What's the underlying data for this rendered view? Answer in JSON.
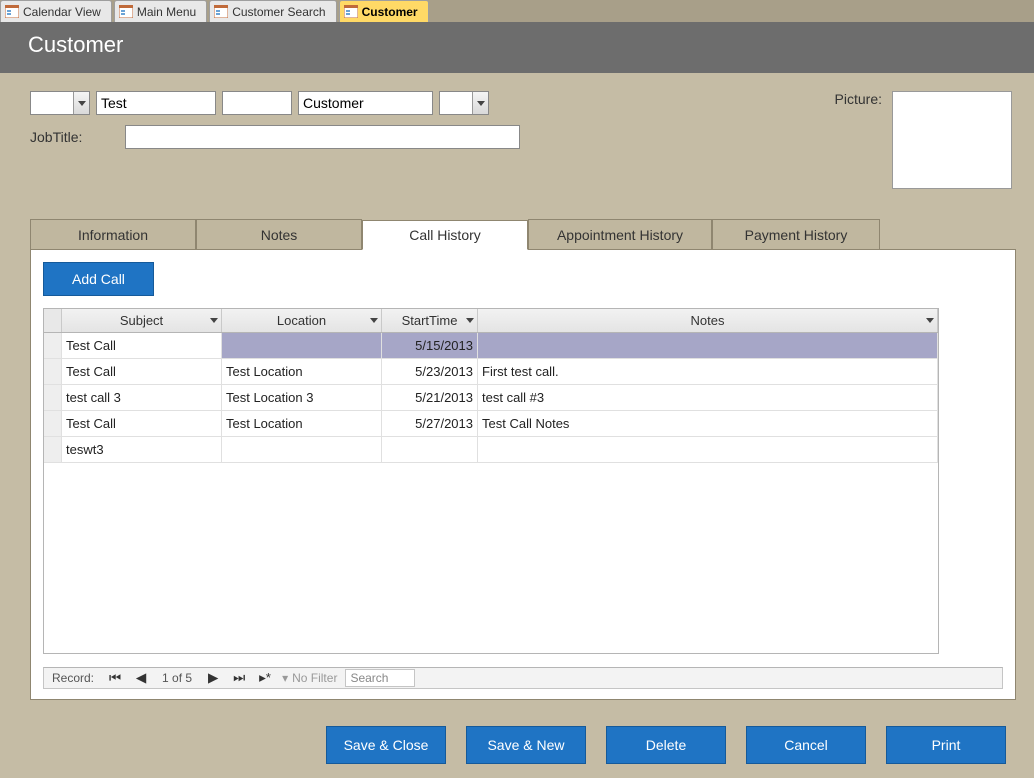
{
  "doc_tabs": [
    {
      "label": "Calendar View",
      "active": false
    },
    {
      "label": "Main Menu",
      "active": false
    },
    {
      "label": "Customer Search",
      "active": false
    },
    {
      "label": "Customer",
      "active": true
    }
  ],
  "header": {
    "title": "Customer"
  },
  "fields": {
    "prefix_value": "",
    "first_name": "Test",
    "middle_name": "",
    "last_name": "Customer",
    "suffix_value": "",
    "job_title_label": "JobTitle:",
    "job_title_value": "",
    "picture_label": "Picture:"
  },
  "inner_tabs": {
    "information": "Information",
    "notes": "Notes",
    "call_history": "Call History",
    "appointment_history": "Appointment History",
    "payment_history": "Payment History"
  },
  "call_panel": {
    "add_call_label": "Add Call",
    "columns": {
      "subject": "Subject",
      "location": "Location",
      "start_time": "StartTime",
      "notes": "Notes"
    },
    "rows": [
      {
        "subject": "Test Call",
        "location": "",
        "start": "5/15/2013",
        "notes": "",
        "selected": true
      },
      {
        "subject": "Test Call",
        "location": "Test Location",
        "start": "5/23/2013",
        "notes": "First test call."
      },
      {
        "subject": "test call 3",
        "location": "Test Location 3",
        "start": "5/21/2013",
        "notes": "test call #3"
      },
      {
        "subject": "Test Call",
        "location": "Test Location",
        "start": "5/27/2013",
        "notes": "Test Call Notes"
      },
      {
        "subject": "teswt3",
        "location": "",
        "start": "",
        "notes": ""
      }
    ],
    "record_nav": {
      "label": "Record:",
      "position": "1 of 5",
      "no_filter": "No Filter",
      "search": "Search"
    }
  },
  "footer": {
    "save_close": "Save & Close",
    "save_new": "Save & New",
    "delete": "Delete",
    "cancel": "Cancel",
    "print": "Print"
  }
}
